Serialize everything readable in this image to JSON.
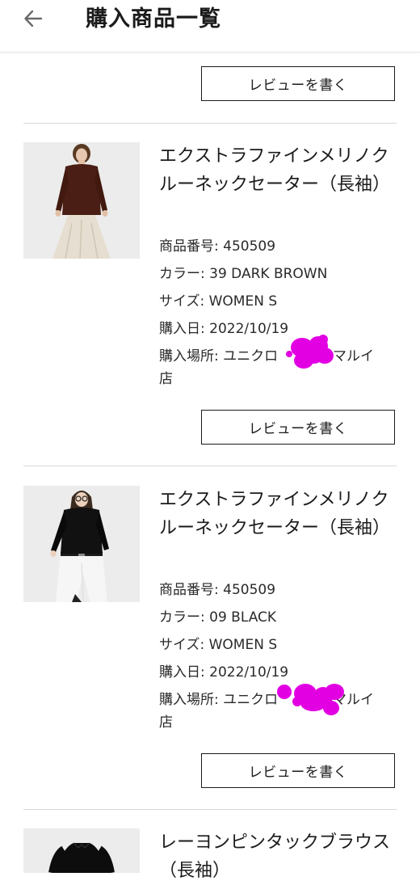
{
  "header": {
    "title": "購入商品一覧"
  },
  "review_button_label": "レビューを書く",
  "products": [
    {
      "name": "エクストラファインメリノクルーネックセーター（長袖）",
      "item_number": "商品番号: 450509",
      "color": "カラー: 39 DARK BROWN",
      "size": "サイズ: WOMEN S",
      "purchase_date": "購入日: 2022/10/19",
      "store": "購入場所: ユニクロ",
      "store_tail": "マルイ",
      "store_line2": "店",
      "thumb_colors": {
        "sweater": "#4a1e14",
        "skirt": "#e8e0d0",
        "bg": "#ececec"
      }
    },
    {
      "name": "エクストラファインメリノクルーネックセーター（長袖）",
      "item_number": "商品番号: 450509",
      "color": "カラー: 09 BLACK",
      "size": "サイズ: WOMEN S",
      "purchase_date": "購入日: 2022/10/19",
      "store": "購入場所: ユニクロ",
      "store_tail": "マルイ",
      "store_line2": "店",
      "thumb_colors": {
        "sweater": "#111111",
        "pants": "#f4f4f4",
        "bg": "#ececec"
      }
    },
    {
      "name": "レーヨンピンタックブラウス（長袖）",
      "thumb_colors": {
        "blouse": "#0d0d0d",
        "bg": "#ececec"
      }
    }
  ],
  "redaction_color": "#e200e2"
}
